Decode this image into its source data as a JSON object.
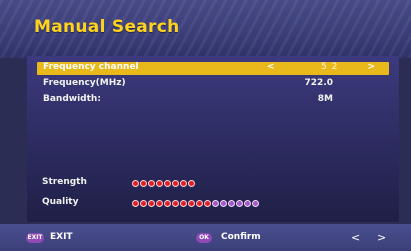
{
  "header": {
    "title": "Manual Search"
  },
  "rows": [
    {
      "label": "Frequency channel",
      "value": "52",
      "selected": true
    },
    {
      "label": "Frequency(MHz)",
      "value": "722.0"
    },
    {
      "label": "Bandwidth:",
      "value": "8M"
    }
  ],
  "arrows": {
    "left": "<",
    "right": ">"
  },
  "signal": {
    "strength_label": "Strength",
    "quality_label": "Quality",
    "strength_level": 8,
    "quality_red": 10,
    "quality_purple": 6
  },
  "footer": {
    "exit_key": "EXIT",
    "exit_label": "EXIT",
    "ok_key": "OK",
    "confirm_label": "Confirm",
    "nav_left": "<",
    "nav_right": ">"
  },
  "colors": {
    "title": "#ffd21c",
    "highlight": "#e9b91c",
    "strength_dot": "#e0202a",
    "quality_dot": "#a35ac2",
    "background": "#2b2d55"
  }
}
